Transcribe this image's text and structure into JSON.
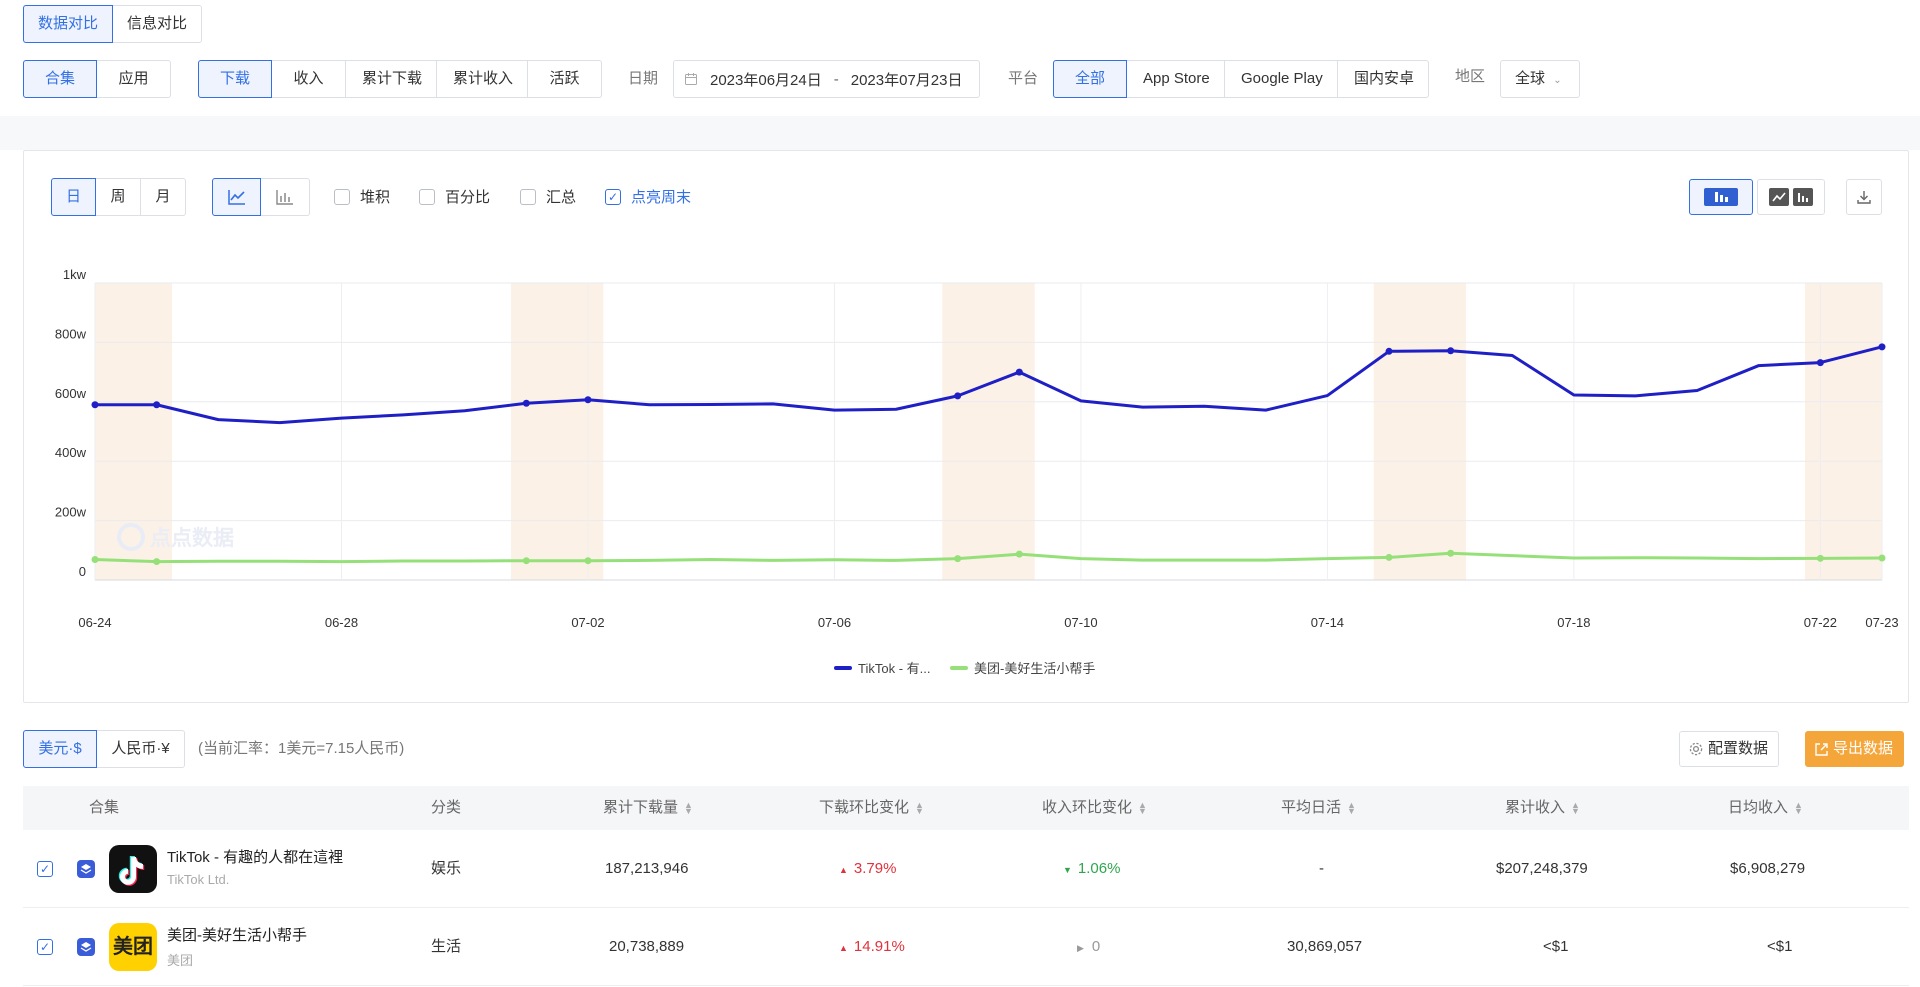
{
  "top_tabs": [
    "数据对比",
    "信息对比"
  ],
  "scope_tabs": [
    "合集",
    "应用"
  ],
  "metric_tabs": [
    "下载",
    "收入",
    "累计下载",
    "累计收入",
    "活跃"
  ],
  "date_label": "日期",
  "date_start": "2023年06月24日",
  "date_sep": "-",
  "date_end": "2023年07月23日",
  "platform_label": "平台",
  "platform_tabs": [
    "全部",
    "App Store",
    "Google Play",
    "国内安卓"
  ],
  "region_label": "地区",
  "region_value": "全球",
  "period_tabs": [
    "日",
    "周",
    "月"
  ],
  "checkboxes": [
    {
      "label": "堆积",
      "checked": false
    },
    {
      "label": "百分比",
      "checked": false
    },
    {
      "label": "汇总",
      "checked": false
    },
    {
      "label": "点亮周末",
      "checked": true
    }
  ],
  "watermark": "点点数据",
  "chart_data": {
    "type": "line",
    "y_ticks": [
      "1kw",
      "800w",
      "600w",
      "400w",
      "200w",
      "0"
    ],
    "ylim": [
      0,
      1000
    ],
    "x_ticks": [
      "06-24",
      "06-28",
      "07-02",
      "07-06",
      "07-10",
      "07-14",
      "07-18",
      "07-22",
      "07-23"
    ],
    "x": [
      "06-24",
      "06-25",
      "06-26",
      "06-27",
      "06-28",
      "06-29",
      "06-30",
      "07-01",
      "07-02",
      "07-03",
      "07-04",
      "07-05",
      "07-06",
      "07-07",
      "07-08",
      "07-09",
      "07-10",
      "07-11",
      "07-12",
      "07-13",
      "07-14",
      "07-15",
      "07-16",
      "07-17",
      "07-18",
      "07-19",
      "07-20",
      "07-21",
      "07-22",
      "07-23"
    ],
    "weekend_ranges": [
      [
        "06-24",
        "06-25"
      ],
      [
        "07-01",
        "07-02"
      ],
      [
        "07-08",
        "07-09"
      ],
      [
        "07-15",
        "07-16"
      ],
      [
        "07-22",
        "07-23"
      ]
    ],
    "series": [
      {
        "name": "TikTok - 有...",
        "color": "#1f1fc6",
        "values": [
          590,
          590,
          540,
          530,
          545,
          556,
          570,
          595,
          607,
          590,
          591,
          593,
          572,
          575,
          620,
          700,
          603,
          582,
          585,
          572,
          621,
          770,
          772,
          756,
          623,
          620,
          638,
          722,
          732,
          785
        ]
      },
      {
        "name": "美团-美好生活小帮手",
        "color": "#96e07a",
        "values": [
          69,
          62,
          63,
          63,
          62,
          64,
          64,
          65,
          65,
          66,
          69,
          66,
          68,
          66,
          72,
          87,
          72,
          67,
          67,
          67,
          72,
          76,
          90,
          82,
          74,
          75,
          74,
          72,
          73,
          74
        ]
      }
    ]
  },
  "currency_tabs": [
    "美元·$",
    "人民币·¥"
  ],
  "exchange_note": "(当前汇率：1美元=7.15人民币)",
  "config_btn": "配置数据",
  "export_btn": "导出数据",
  "table": {
    "headers": [
      "合集",
      "分类",
      "累计下载量",
      "下载环比变化",
      "收入环比变化",
      "平均日活",
      "累计收入",
      "日均收入"
    ],
    "rows": [
      {
        "name": "TikTok - 有趣的人都在這裡",
        "developer": "TikTok Ltd.",
        "category": "娱乐",
        "downloads": "187,213,946",
        "dl_change": "3.79%",
        "dl_dir": "up",
        "rev_change": "1.06%",
        "rev_dir": "down",
        "dau": "-",
        "revenue": "$207,248,379",
        "daily_rev": "$6,908,279"
      },
      {
        "name": "美团-美好生活小帮手",
        "developer": "美团",
        "category": "生活",
        "downloads": "20,738,889",
        "dl_change": "14.91%",
        "dl_dir": "up",
        "rev_change": "0",
        "rev_dir": "flat",
        "dau": "30,869,057",
        "revenue": "<$1",
        "daily_rev": "<$1",
        "icon_text": "美团"
      }
    ]
  }
}
